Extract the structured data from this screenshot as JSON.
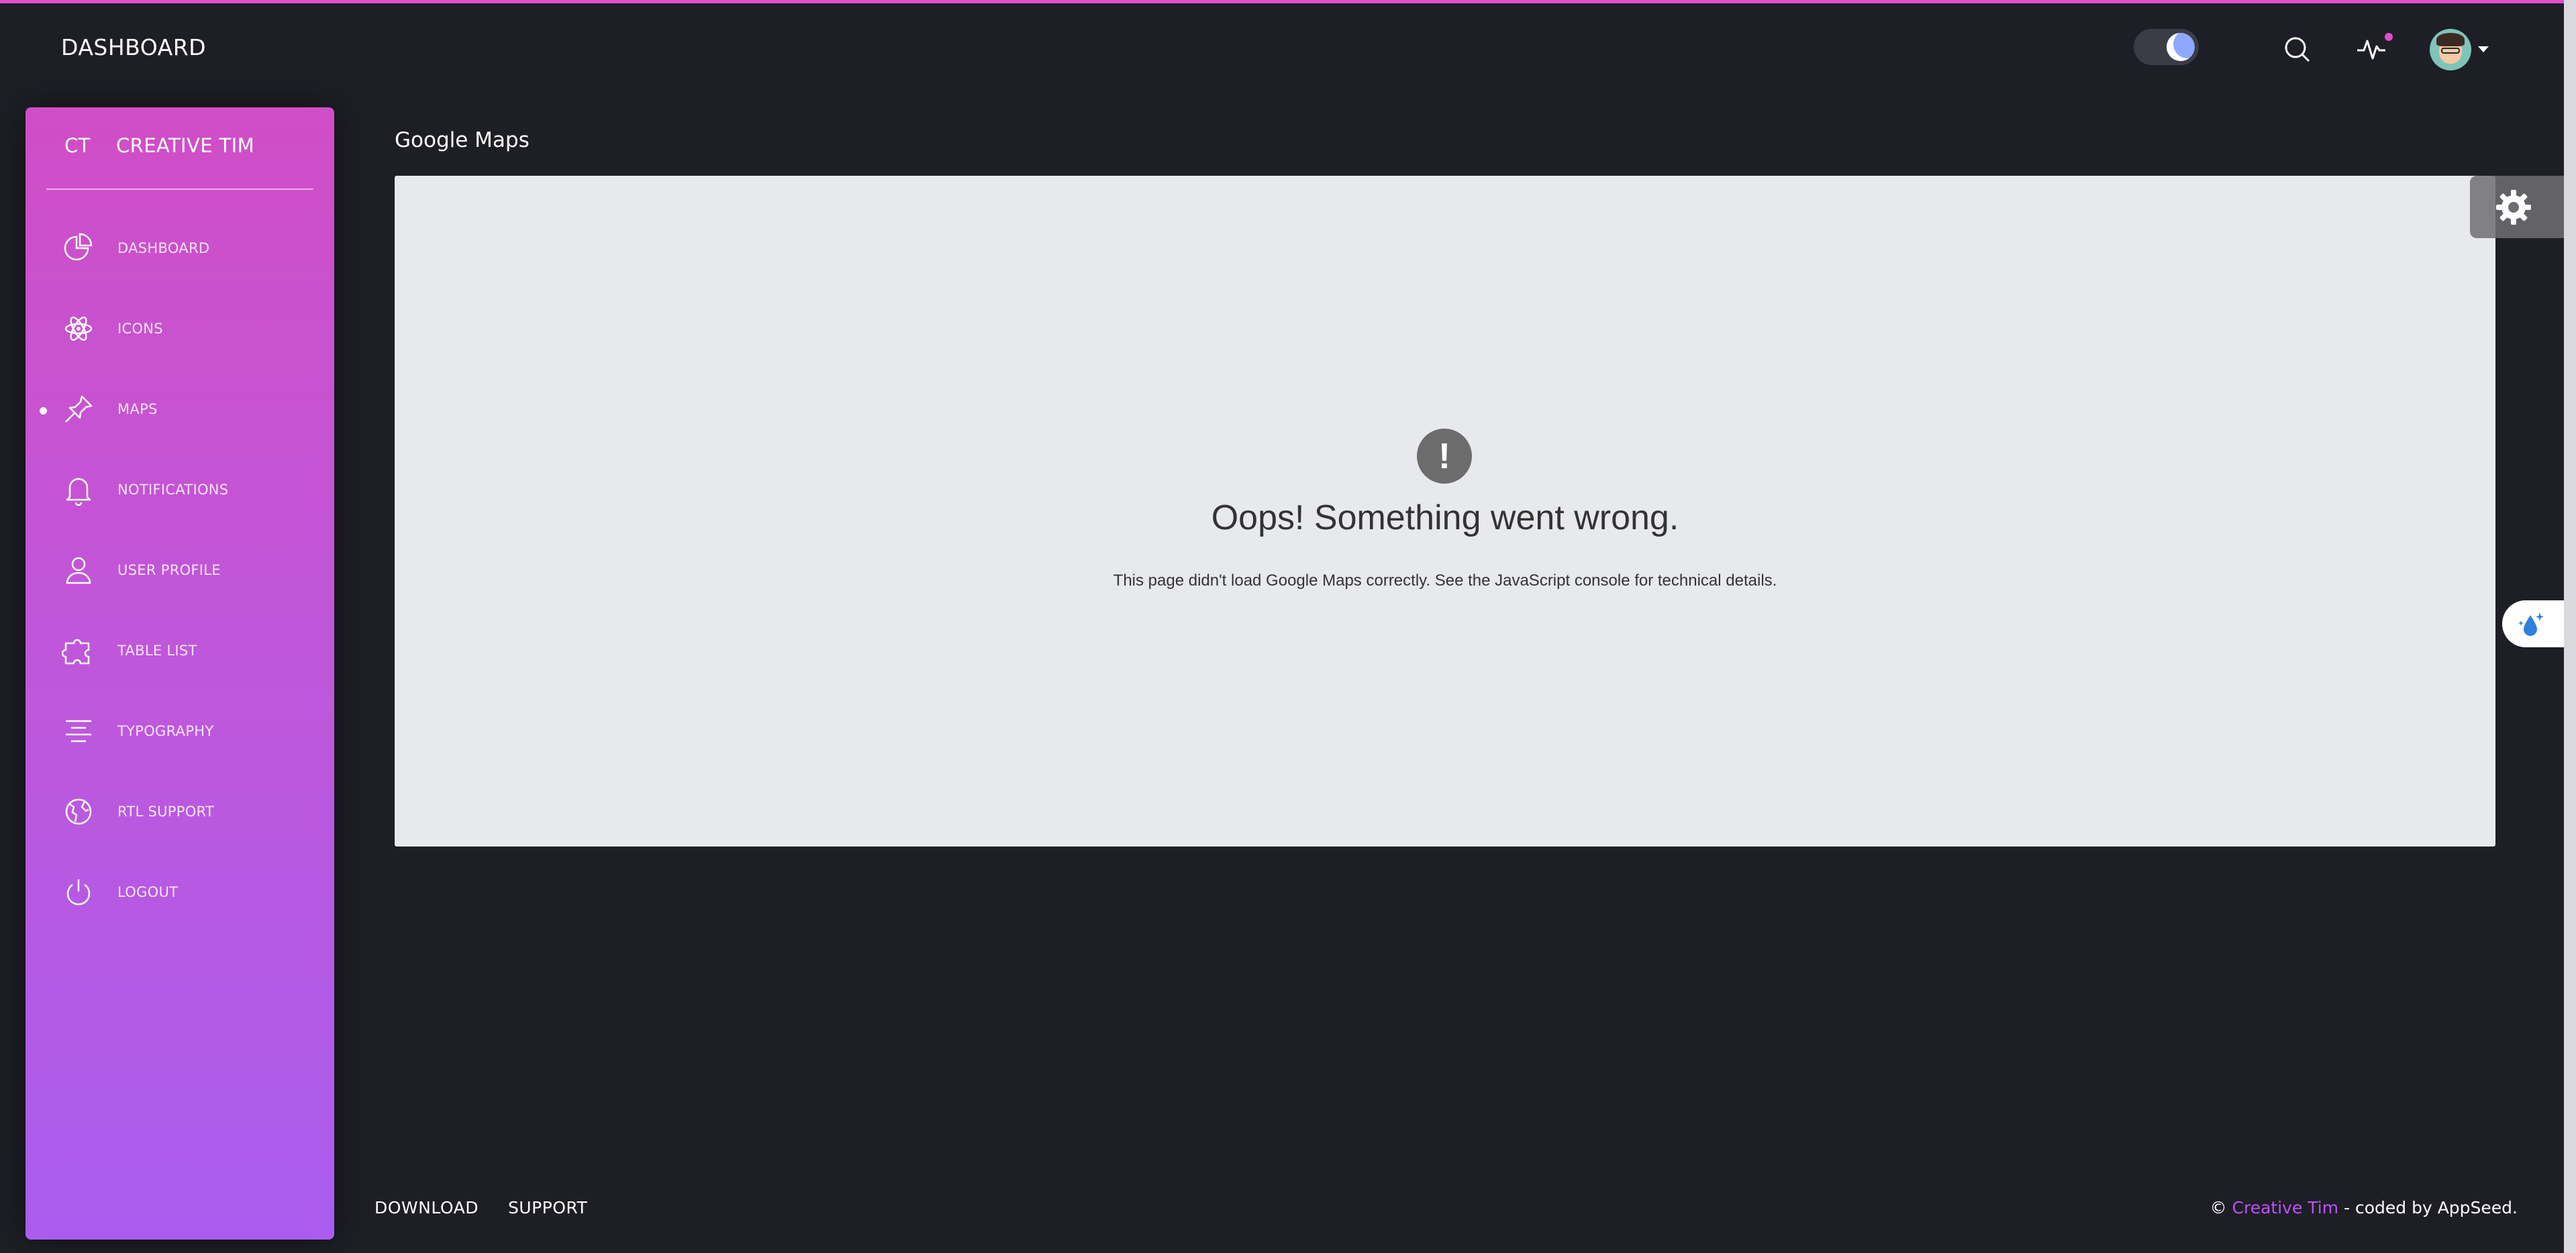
{
  "header": {
    "title": "DASHBOARD",
    "theme_toggle": "dark-mode-toggle",
    "icons": [
      "search-icon",
      "pulse-icon",
      "avatar"
    ]
  },
  "sidebar": {
    "logo_mini": "CT",
    "logo_text": "CREATIVE TIM",
    "active_item": "MAPS",
    "items": [
      {
        "label": "DASHBOARD",
        "icon": "chart-pie-icon"
      },
      {
        "label": "ICONS",
        "icon": "atom-icon"
      },
      {
        "label": "MAPS",
        "icon": "pin-icon"
      },
      {
        "label": "NOTIFICATIONS",
        "icon": "bell-icon"
      },
      {
        "label": "USER PROFILE",
        "icon": "user-icon"
      },
      {
        "label": "TABLE LIST",
        "icon": "puzzle-icon"
      },
      {
        "label": "TYPOGRAPHY",
        "icon": "align-center-icon"
      },
      {
        "label": "RTL SUPPORT",
        "icon": "world-icon"
      },
      {
        "label": "LOGOUT",
        "icon": "power-icon"
      }
    ]
  },
  "main": {
    "title": "Google Maps",
    "error_title": "Oops! Something went wrong.",
    "error_detail": "This page didn't load Google Maps correctly. See the JavaScript console for technical details."
  },
  "footer": {
    "links": [
      "DOWNLOAD",
      "SUPPORT"
    ],
    "copyright_prefix": "©",
    "brand": "Creative Tim",
    "copyright_suffix": " - coded by AppSeed."
  },
  "colors": {
    "accent": "#e14eca",
    "background": "#1e1e26",
    "sidebar_top": "#d04ec7",
    "sidebar_bottom": "#a95cee",
    "brand_link": "#ba54f5"
  }
}
